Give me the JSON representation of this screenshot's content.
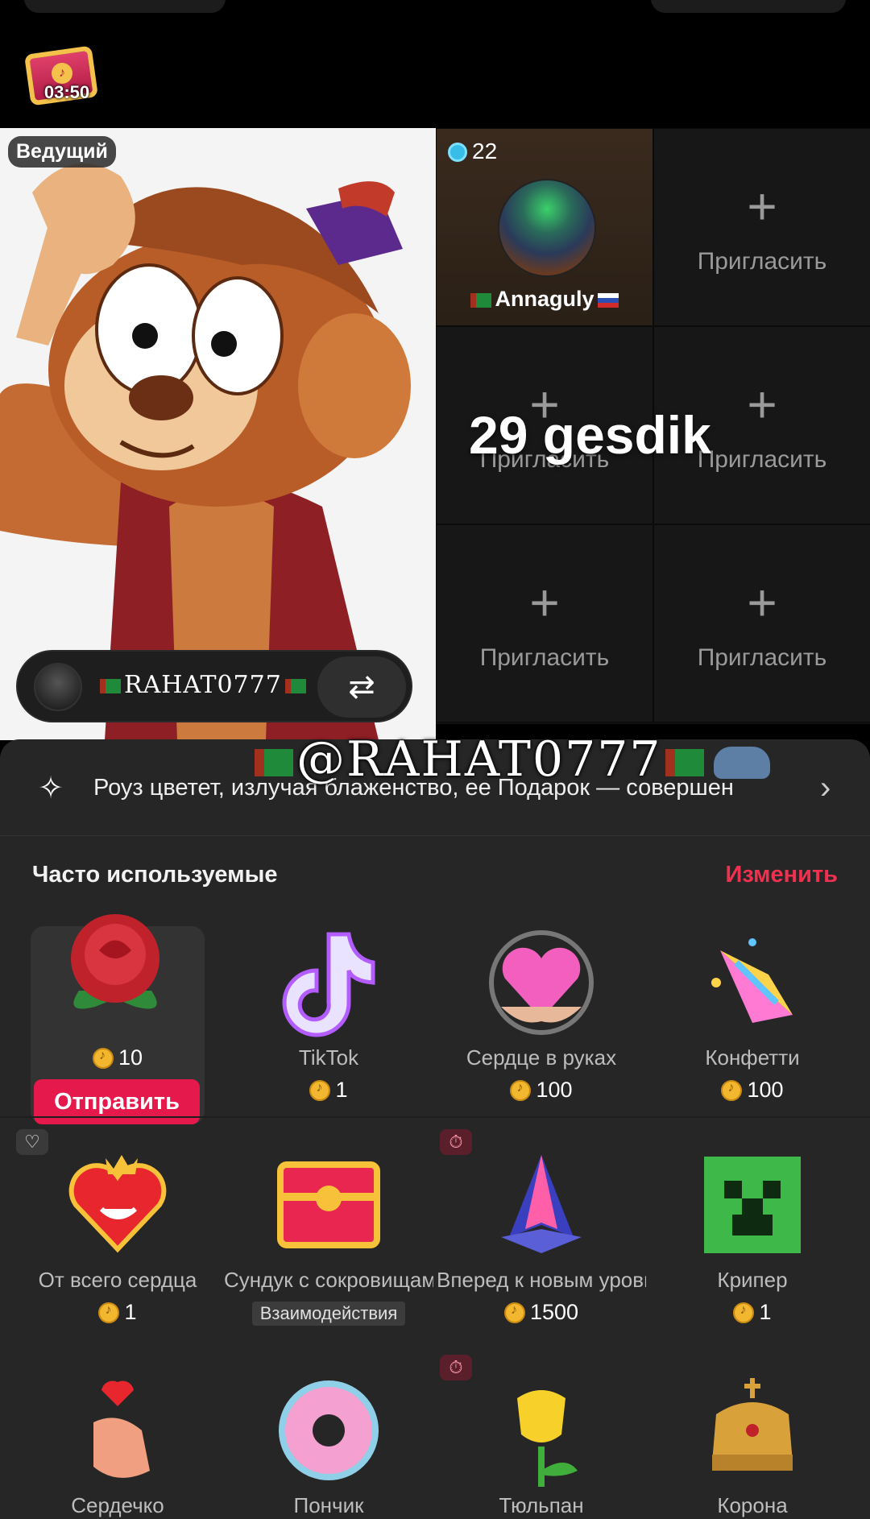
{
  "top": {
    "timer": "03:50"
  },
  "host": {
    "badge": "Ведущий",
    "name": "RAHAT0777",
    "swap_icon": "swap-arrows-icon"
  },
  "guests": {
    "count": "22",
    "name": "Annaguly",
    "invite_label": "Пригласить",
    "plus_icon": "plus-icon"
  },
  "overlay": {
    "title": "29 gesdik",
    "watermark": "@RAHAT0777"
  },
  "banner": {
    "text": "Роуз цветет, излучая блаженство, ее Подарок — совершен"
  },
  "section": {
    "title": "Часто используемые",
    "edit": "Изменить"
  },
  "gifts_row1": [
    {
      "name": "Роза",
      "price": "10",
      "send": "Отправить"
    },
    {
      "name": "TikTok",
      "price": "1"
    },
    {
      "name": "Сердце в руках",
      "price": "100"
    },
    {
      "name": "Конфетти",
      "price": "100"
    }
  ],
  "gifts_row2": [
    {
      "name": "От всего сердца",
      "price": "1"
    },
    {
      "name": "Сундук с сокровищами",
      "tag": "Взаимодействия"
    },
    {
      "name": "Вперед к новым уровн...",
      "price": "1500"
    },
    {
      "name": "Крипер",
      "price": "1"
    }
  ],
  "gifts_row3": [
    {
      "name": "Сердечко"
    },
    {
      "name": "Пончик"
    },
    {
      "name": "Тюльпан"
    },
    {
      "name": "Корона"
    }
  ],
  "colors": {
    "accent": "#e5194b",
    "edit_link": "#f0304f",
    "coin": "#f2b72e",
    "sheet_bg": "#262626"
  }
}
